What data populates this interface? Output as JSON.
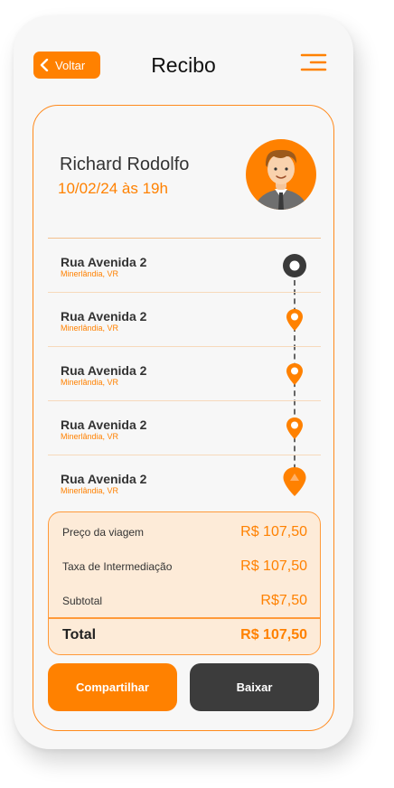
{
  "header": {
    "back_label": "Voltar",
    "title": "Recibo"
  },
  "receipt": {
    "passenger_name": "Richard Rodolfo",
    "date_time": "10/02/24 às 19h"
  },
  "stops": [
    {
      "street": "Rua Avenida 2",
      "city": "Minerlândia, VR",
      "marker": "origin-circle-icon"
    },
    {
      "street": "Rua Avenida 2",
      "city": "Minerlândia, VR",
      "marker": "pin-icon"
    },
    {
      "street": "Rua Avenida 2",
      "city": "Minerlândia, VR",
      "marker": "pin-icon"
    },
    {
      "street": "Rua Avenida 2",
      "city": "Minerlândia, VR",
      "marker": "pin-icon"
    },
    {
      "street": "Rua Avenida 2",
      "city": "Minerlândia, VR",
      "marker": "destination-pin-icon"
    }
  ],
  "summary": {
    "trip_price_label": "Preço da viagem",
    "trip_price_value": "R$ 107,50",
    "fee_label": "Taxa de Intermediação",
    "fee_value": "R$ 107,50",
    "subtotal_label": "Subtotal",
    "subtotal_value": "R$7,50",
    "total_label": "Total",
    "total_value": "R$ 107,50"
  },
  "actions": {
    "share_label": "Compartilhar",
    "download_label": "Baixar"
  },
  "colors": {
    "accent": "#ff8100",
    "dark": "#3c3c3c",
    "summary_bg": "#fdebd8"
  }
}
